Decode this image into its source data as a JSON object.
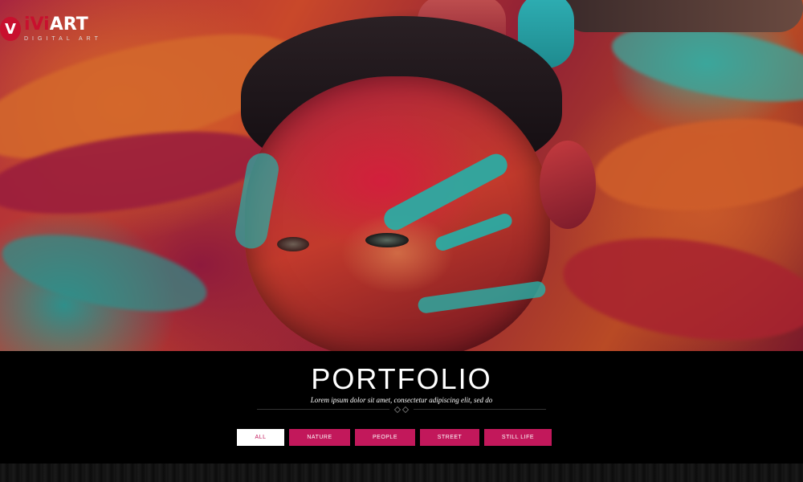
{
  "logo": {
    "mark": "V",
    "title_prefix": "iVi",
    "title_suffix": "ART",
    "subtitle": "DIGITAL ART"
  },
  "hero": {
    "image_alt": "Colorful painted face"
  },
  "portfolio": {
    "title": "PORTFOLIO",
    "subtitle": "Lorem ipsum dolor sit amet, consectetur adipiscing elit, sed do",
    "filters": [
      {
        "label": "ALL",
        "active": true
      },
      {
        "label": "NATURE",
        "active": false
      },
      {
        "label": "PEOPLE",
        "active": false
      },
      {
        "label": "STREET",
        "active": false
      },
      {
        "label": "STILL LIFE",
        "active": false
      }
    ]
  },
  "colors": {
    "accent": "#c2185b",
    "logo_red": "#c8102e",
    "background": "#000000"
  }
}
